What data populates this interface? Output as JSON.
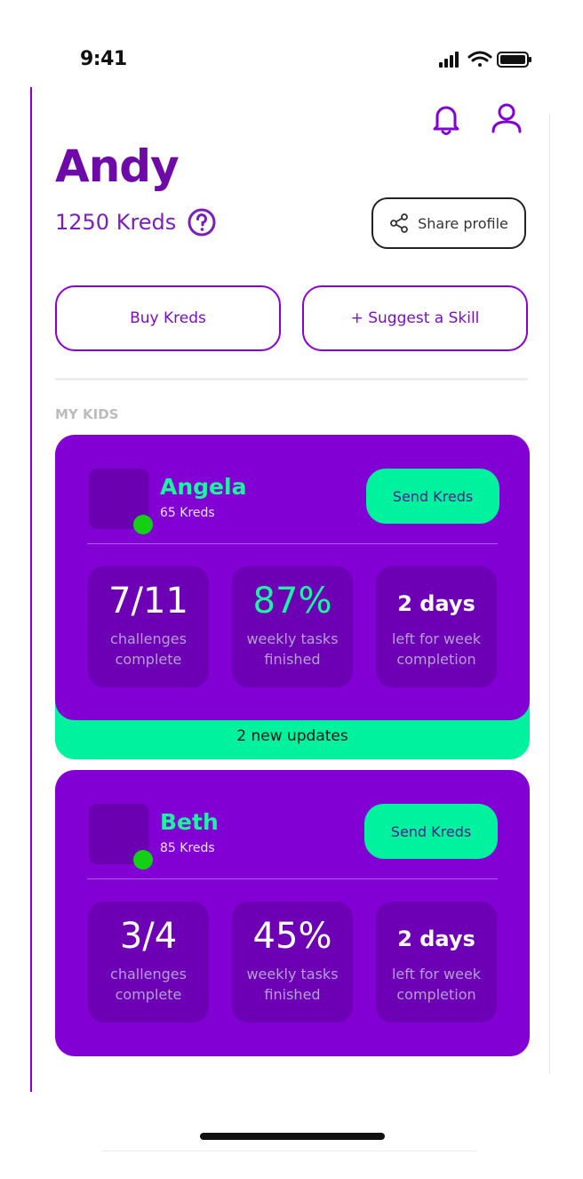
{
  "status": {
    "time": "9:41"
  },
  "header": {
    "title": "Andy",
    "kreds": "1250 Kreds",
    "share_label": "Share profile"
  },
  "actions": {
    "buy_label": "Buy Kreds",
    "suggest_label": "+ Suggest a Skill"
  },
  "section": {
    "label": "MY KIDS"
  },
  "kids": [
    {
      "name": "Angela",
      "kreds": "65 Kreds",
      "send_label": "Send Kreds",
      "stats": [
        {
          "value": "7/11",
          "line1": "challenges",
          "line2": "complete"
        },
        {
          "value": "87%",
          "line1": "weekly tasks",
          "line2": "finished"
        },
        {
          "value": "2 days",
          "line1": "left for week",
          "line2": "completion"
        }
      ],
      "updates": "2 new updates"
    },
    {
      "name": "Beth",
      "kreds": "85 Kreds",
      "send_label": "Send Kreds",
      "stats": [
        {
          "value": "3/4",
          "line1": "challenges",
          "line2": "complete"
        },
        {
          "value": "45%",
          "line1": "weekly tasks",
          "line2": "finished"
        },
        {
          "value": "2 days",
          "line1": "left for week",
          "line2": "completion"
        }
      ]
    }
  ],
  "colors": {
    "purple": "#8200d4",
    "accent_green": "#00f29e",
    "online": "#14d014"
  }
}
